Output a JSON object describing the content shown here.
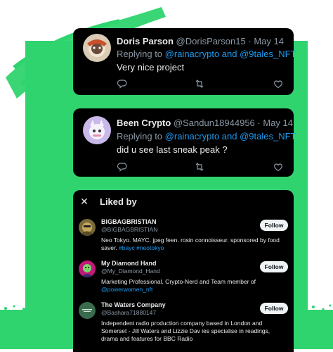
{
  "tweets": [
    {
      "name": "Doris Parson",
      "handle": "@DorisParson15",
      "separator": "·",
      "date": "May 14",
      "replying_prefix": "Replying to",
      "replying_mentions": "@rainacrypto and @9tales_NFT",
      "text": "Very nice project"
    },
    {
      "name": "Been Crypto",
      "handle": "@Sandun18944956",
      "separator": "·",
      "date": "May 14",
      "replying_prefix": "Replying to",
      "replying_mentions": "@rainacrypto and @9tales_NFT",
      "text": "did u see last sneak peak ?"
    }
  ],
  "liked_by": {
    "title": "Liked by",
    "close_icon": "✕",
    "users": [
      {
        "name": "BIGBAGBRISTIAN",
        "handle": "@BIGBAGBRISTIAN",
        "bio": "Neo Tokyo. MAYC. jpeg feen. rosin connoisseur. sponsored by food saver.",
        "bio_links": "#bayc #neotokyo",
        "follow_label": "Follow"
      },
      {
        "name": "My Diamond Hand",
        "handle": "@My_Diamond_Hand",
        "bio": "Marketing Professional, Crypto-Nerd and Team member of",
        "bio_links": "@powerwomen_nft",
        "follow_label": "Follow"
      },
      {
        "name": "The Waters Company",
        "handle": "@Bashara71880147",
        "bio": "Independent radio production company based in London and Somerset - Jill Waters and Lizzie Dav ies specialise in readings, drama and features for BBC Radio",
        "bio_links": "",
        "follow_label": "Follow"
      }
    ]
  },
  "colors": {
    "accent_green": "#2fd46f",
    "card_bg": "#000000",
    "link_blue": "#1d9bf0",
    "muted_text": "#8b98a5"
  },
  "icons": [
    "reply-icon",
    "retweet-icon",
    "like-icon",
    "close-icon"
  ]
}
